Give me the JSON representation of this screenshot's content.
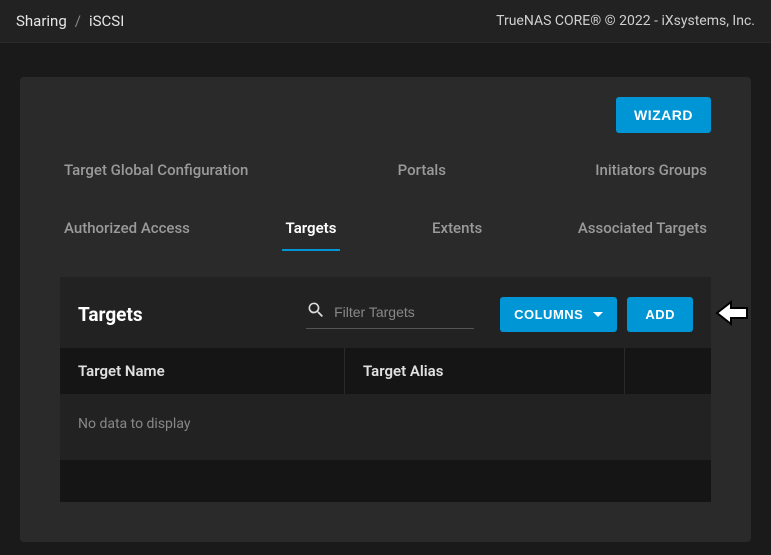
{
  "breadcrumb": {
    "root": "Sharing",
    "sep": "/",
    "current": "iSCSI"
  },
  "copyright": "TrueNAS CORE® © 2022 - iXsystems, Inc.",
  "wizard_button": "WIZARD",
  "tabs_row1": {
    "global_config": "Target Global Configuration",
    "portals": "Portals",
    "initiators": "Initiators Groups"
  },
  "tabs_row2": {
    "authorized": "Authorized Access",
    "targets": "Targets",
    "extents": "Extents",
    "associated": "Associated Targets"
  },
  "section": {
    "title": "Targets",
    "search_placeholder": "Filter Targets",
    "columns_button": "COLUMNS",
    "add_button": "ADD",
    "table": {
      "col_name": "Target Name",
      "col_alias": "Target Alias"
    },
    "no_data": "No data to display"
  }
}
